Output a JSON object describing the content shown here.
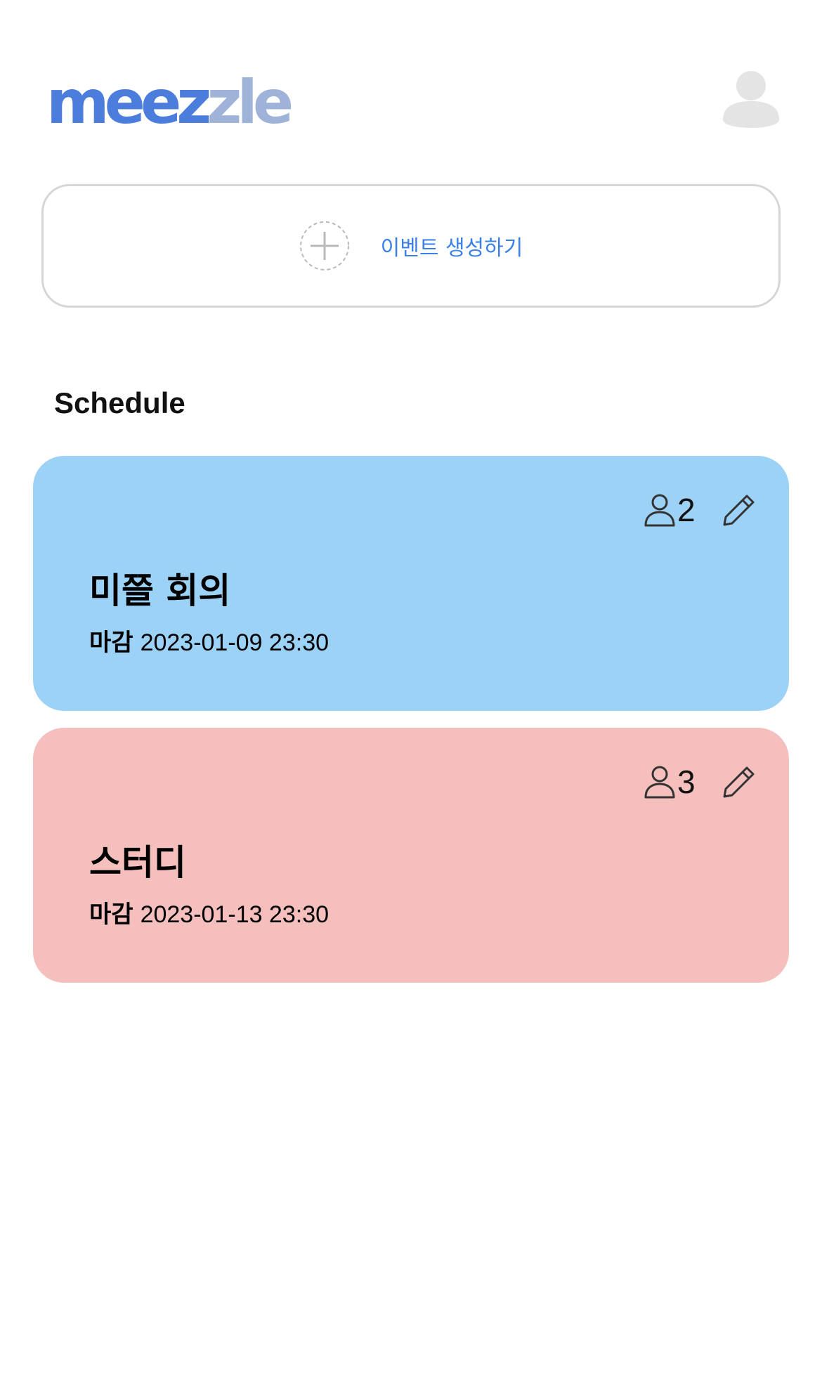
{
  "app": {
    "logo_part1": "meez",
    "logo_part2": "zle",
    "colors": {
      "logo_primary": "#4a7ddc",
      "logo_secondary": "#9fb3d8",
      "link_blue": "#3a80e6"
    }
  },
  "header": {
    "avatar_icon": "user-avatar-icon"
  },
  "create_event": {
    "label": "이벤트 생성하기",
    "icon": "plus-circle-icon"
  },
  "schedule": {
    "title": "Schedule",
    "events": [
      {
        "title": "미쯜 회의",
        "deadline_label": "마감",
        "deadline": "2023-01-09 23:30",
        "participants": "2",
        "color": "#9dd2f7"
      },
      {
        "title": "스터디",
        "deadline_label": "마감",
        "deadline": "2023-01-13 23:30",
        "participants": "3",
        "color": "#f5bfbe"
      }
    ]
  }
}
